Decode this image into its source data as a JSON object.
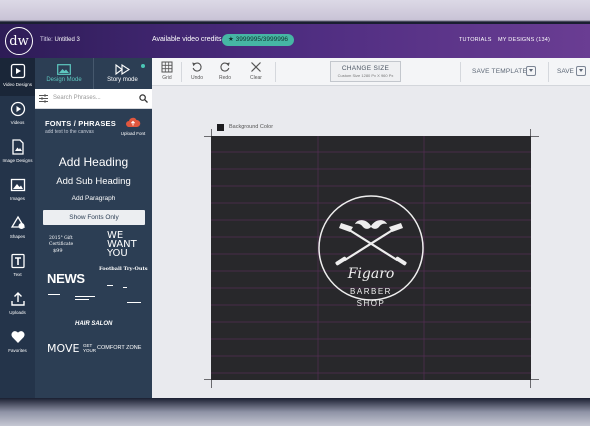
{
  "app": {
    "logo_text": "dw",
    "title_prefix": "Title:",
    "title_value": "Untitled 3",
    "credits_label": "Available video credits",
    "credits_value": "★ 3999995/3999996",
    "links": [
      "TUTORIALS",
      "MY DESIGNS (134)"
    ]
  },
  "rail": [
    {
      "label": "Video Designs",
      "icon": "video-design-icon"
    },
    {
      "label": "Videos",
      "icon": "video-play-icon"
    },
    {
      "label": "Image Designs",
      "icon": "image-design-icon"
    },
    {
      "label": "Images",
      "icon": "image-icon"
    },
    {
      "label": "Shapes",
      "icon": "shapes-icon"
    },
    {
      "label": "Text",
      "icon": "text-icon"
    },
    {
      "label": "Uploads",
      "icon": "upload-icon"
    },
    {
      "label": "Favorites",
      "icon": "heart-icon"
    }
  ],
  "panel": {
    "design_mode": "Design Mode",
    "story_mode": "Story mode",
    "search_placeholder": "Search Phrases...",
    "fonts_title": "FONTS / PHRASES",
    "fonts_sub": "add text to the canvas",
    "upload_font": "Upload Font",
    "add_heading": "Add Heading",
    "add_sub_heading": "Add Sub Heading",
    "add_paragraph": "Add Paragraph",
    "show_fonts_only": "Show Fonts Only",
    "samples": {
      "s1a": "2015° Gift",
      "s1b": "Certificate",
      "s1c": "$99",
      "s2": [
        "WE",
        "WANT",
        "YOU"
      ],
      "s3": "NEWS",
      "s4": "Football Try-Outs",
      "s5": "HAIR SALON",
      "s6": "MOVE",
      "s7a": "GET",
      "s7b": "YOUR",
      "s7c": "COMFORT ZONE"
    }
  },
  "toolbar": {
    "grid": "Grid",
    "undo": "Undo",
    "redo": "Redo",
    "clear": "Clear",
    "change_size": "CHANGE SIZE",
    "custom_size": "Custom Size 1280 Px X 960 Px",
    "save_template": "SAVE TEMPLATE",
    "save": "SAVE"
  },
  "workspace": {
    "background_label": "Background Color"
  },
  "logo": {
    "script": "Figaro",
    "line1": "BARBER",
    "line2": "SHOP"
  }
}
